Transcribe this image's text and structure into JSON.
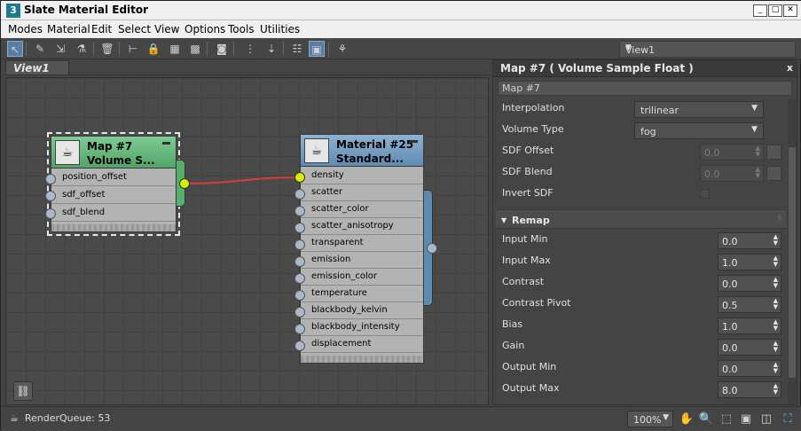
{
  "window": {
    "title": "Slate Material Editor",
    "app_icon": "3",
    "buttons": [
      "minimize-icon",
      "maximize-icon",
      "close-icon"
    ]
  },
  "menu": [
    "Modes",
    "Material",
    "Edit",
    "Select",
    "View",
    "Options",
    "Tools",
    "Utilities"
  ],
  "toolbar": {
    "view_selector": "View1"
  },
  "view_tab": "View1",
  "nodes": {
    "map7": {
      "title1": "Map #7",
      "title2": "Volume  S...",
      "slots": [
        "position_offset",
        "sdf_offset",
        "sdf_blend"
      ],
      "color": "#5fae76"
    },
    "mat25": {
      "title1": "Material #25",
      "title2": "Standard...",
      "slots": [
        "density",
        "scatter",
        "scatter_color",
        "scatter_anisotropy",
        "transparent",
        "emission",
        "emission_color",
        "temperature",
        "blackbody_kelvin",
        "blackbody_intensity",
        "displacement"
      ],
      "color": "#5c8ab0"
    }
  },
  "wire_color": "#d93a3a",
  "panel": {
    "title": "Map #7  ( Volume Sample Float )",
    "close": "x",
    "name": "Map #7",
    "interpolation": {
      "label": "Interpolation",
      "value": "trilinear"
    },
    "volume_type": {
      "label": "Volume Type",
      "value": "fog"
    },
    "sdf_offset": {
      "label": "SDF Offset",
      "value": "0.0"
    },
    "sdf_blend": {
      "label": "SDF Blend",
      "value": "0.0"
    },
    "invert_sdf": {
      "label": "Invert SDF",
      "checked": false
    },
    "rollout": {
      "label": "Remap",
      "expanded": true
    },
    "remap": [
      {
        "label": "Input Min",
        "value": "0.0"
      },
      {
        "label": "Input Max",
        "value": "1.0"
      },
      {
        "label": "Contrast",
        "value": "0.0"
      },
      {
        "label": "Contrast Pivot",
        "value": "0.5"
      },
      {
        "label": "Bias",
        "value": "1.0"
      },
      {
        "label": "Gain",
        "value": "0.0"
      },
      {
        "label": "Output Min",
        "value": "0.0"
      },
      {
        "label": "Output Max",
        "value": "8.0"
      }
    ]
  },
  "status": {
    "render_queue": "RenderQueue: 53",
    "zoom": "100%"
  }
}
